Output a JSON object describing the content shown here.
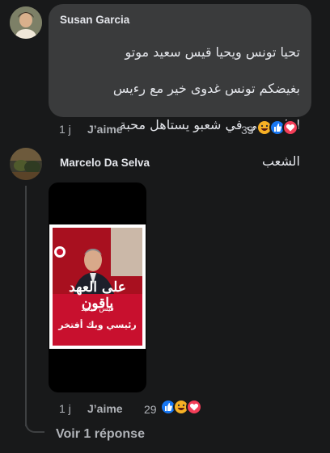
{
  "comment1": {
    "author": "Susan Garcia",
    "text_lines": [
      "تحيا تونس ويحيا قيس سعيد موتو",
      "بغيضكم تونس غدوى خير مع رءيس",
      "اخاف ربي في شعبو يستاهل محبة",
      "الشعب"
    ],
    "time": "1 j",
    "like_label": "J’aime",
    "reaction_count": "33"
  },
  "comment2": {
    "author": "Marcelo Da Selva",
    "time": "1 j",
    "like_label": "J’aime",
    "reaction_count": "29",
    "poster": {
      "headline": "على العهد باقون",
      "name": "قيس سعيد",
      "slogan": "رئيسي وبك أفتخر"
    }
  },
  "replies": {
    "label": "Voir 1 réponse"
  },
  "colors": {
    "background": "#18191a",
    "bubble": "#3a3b3c",
    "like_blue": "#1877f2",
    "love_red": "#f33e58",
    "haha_yellow": "#f7b125",
    "poster_red": "#c8102e"
  },
  "reactions": [
    "haha-icon",
    "like-icon",
    "love-icon"
  ]
}
